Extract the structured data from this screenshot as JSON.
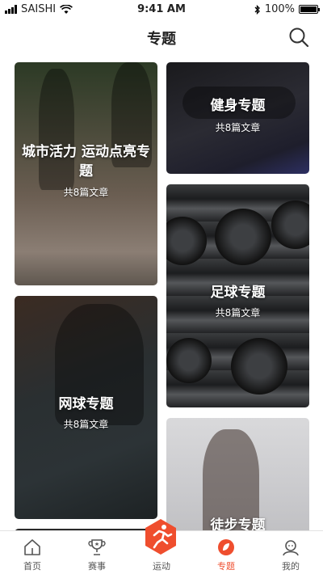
{
  "status_bar": {
    "carrier": "SAISHI",
    "time": "9:41 AM",
    "battery": "100%",
    "battery_level": 1.0,
    "icons": [
      "signal-icon",
      "wifi-icon",
      "bluetooth-icon",
      "battery-icon"
    ]
  },
  "nav": {
    "title": "专题",
    "search_icon": "search-icon"
  },
  "topics": [
    {
      "title": "城市活力 运动点亮专题",
      "count": "共8篇文章"
    },
    {
      "title": "健身专题",
      "count": "共8篇文章"
    },
    {
      "title": "网球专题",
      "count": "共8篇文章"
    },
    {
      "title": "足球专题",
      "count": "共8篇文章"
    },
    {
      "title": "徒步专题",
      "count": ""
    }
  ],
  "tabbar": {
    "accent": "#ef4e2e",
    "items": [
      {
        "label": "首页",
        "icon": "home-icon"
      },
      {
        "label": "赛事",
        "icon": "trophy-icon"
      },
      {
        "label": "运动",
        "icon": "runner-icon"
      },
      {
        "label": "专题",
        "icon": "topic-icon",
        "active": true
      },
      {
        "label": "我的",
        "icon": "profile-icon"
      }
    ]
  }
}
